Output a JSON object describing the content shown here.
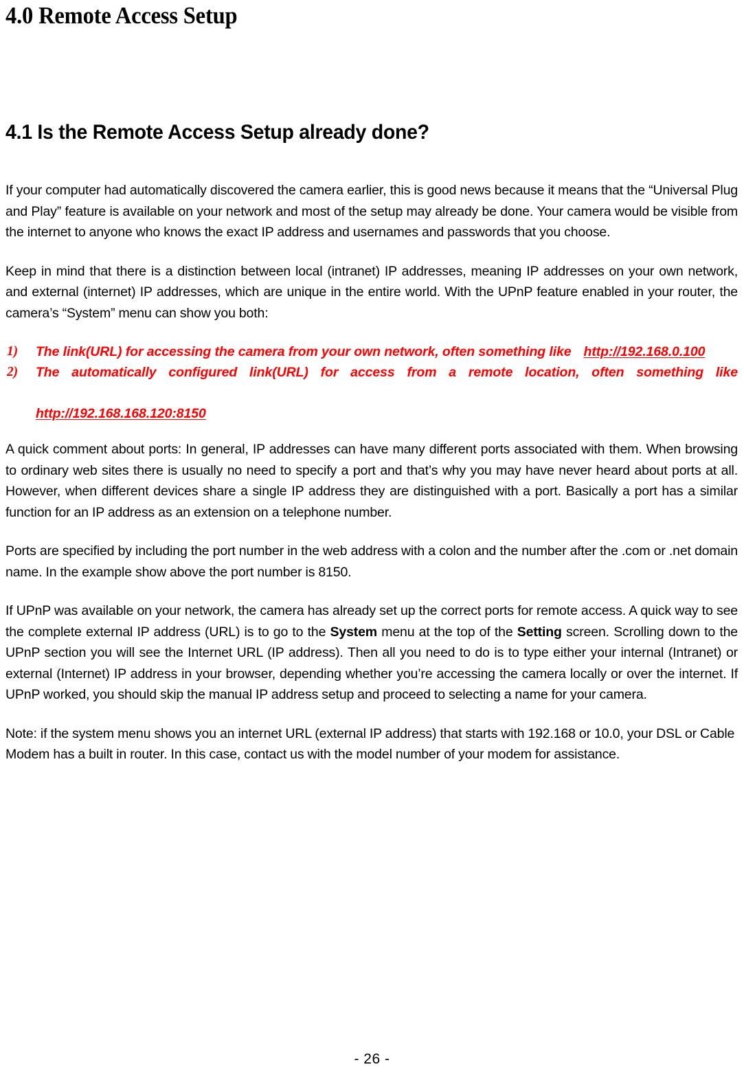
{
  "document": {
    "chapter_heading": "4.0 Remote Access Setup",
    "section_heading": "4.1 Is the Remote Access Setup already done?",
    "page_footer": "- 26 -",
    "accent_color": "#FF0000"
  },
  "paragraphs": {
    "intro": "If your computer had automatically discovered the camera earlier, this is good news because it means that the “Universal Plug and Play” feature is available on your network and most of the setup may already be done. Your camera would be visible from the internet to anyone who knows the exact IP address and usernames and passwords that you choose.",
    "distinction": "Keep in mind that there is a distinction between local (intranet) IP addresses, meaning IP addresses on your own network, and external (internet) IP addresses, which are unique in the entire world. With the UPnP feature enabled in your router, the camera’s “System” menu can show you both:",
    "ports_comment": "A quick comment about ports: In general, IP addresses can have many different ports associated with them. When browsing to ordinary web sites there is usually no need to specify a port and that’s why you may have never heard about ports at all. However, when different devices share a single IP address they are distinguished with a port. Basically a port has a similar function for an IP address as an extension on a telephone number.",
    "ports_specified": "Ports are specified by including the port number in the web address with a colon and the number after the .com or .net domain name. In the example show above the port number is 8150.",
    "upnp_part1": "If UPnP was available on your network, the camera has already set up the correct ports for remote access. A quick way to see the complete external IP address (URL) is to go to the ",
    "upnp_bold1": "System",
    "upnp_part2": " menu at the top of the ",
    "upnp_bold2": "Setting",
    "upnp_part3": " screen. Scrolling down to the UPnP section you will see the Internet URL (IP address). Then all you need to do is to type either your internal (Intranet) or external (Internet) IP address in your browser, depending whether you’re accessing the camera locally or over the internet. If UPnP worked, you should skip the manual IP address setup and proceed to selecting a name for your camera.",
    "note": "Note: if the system menu shows you an internet URL (external IP address) that starts with 192.168 or 10.0, your DSL or Cable Modem has a built in router. In this case, contact us with the model number of your modem for assistance."
  },
  "list": {
    "items": [
      {
        "marker": "1)",
        "text": "The link(URL) for accessing the camera from your own network, often something like",
        "url": "http://192.168.0.100"
      },
      {
        "marker": "2)",
        "text": "The automatically configured link(URL) for access from a remote location, often something like",
        "url": "http://192.168.168.120:8150"
      }
    ]
  }
}
